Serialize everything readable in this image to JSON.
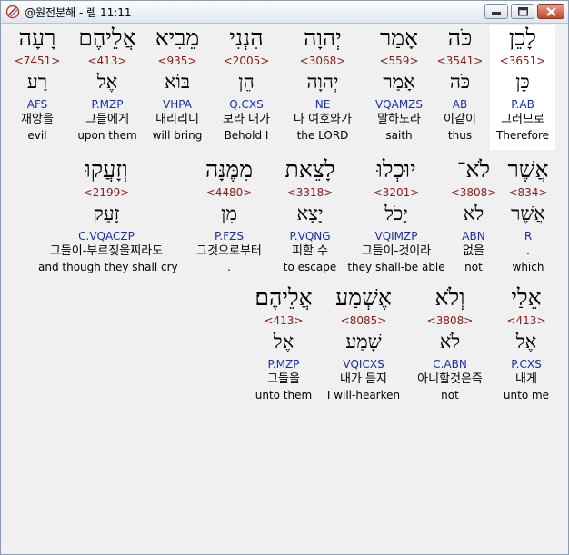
{
  "window": {
    "title": "@원전분해 - 렘 11:11"
  },
  "rows": [
    [
      {
        "hebrew": "רָעָה",
        "strong": "<7451>",
        "lemma": "רַע",
        "morph": "AFS",
        "korean": "재앙을",
        "english": "evil"
      },
      {
        "hebrew": "אֲלֵיהֶם",
        "strong": "<413>",
        "lemma": "אֶל",
        "morph": "P.MZP",
        "korean": "그들에게",
        "english": "upon them"
      },
      {
        "hebrew": "מֵבִיא",
        "strong": "<935>",
        "lemma": "בּוֹא",
        "morph": "VHPA",
        "korean": "내리리니",
        "english": "will bring"
      },
      {
        "hebrew": "הִנְנִי",
        "strong": "<2005>",
        "lemma": "הֵן",
        "morph": "Q.CXS",
        "korean": "보라 내가",
        "english": "Behold I"
      },
      {
        "hebrew": "יְהוָה",
        "strong": "<3068>",
        "lemma": "יְהוָה",
        "morph": "NE",
        "korean": "나 여호와가",
        "english": "the LORD"
      },
      {
        "hebrew": "אָמַר",
        "strong": "<559>",
        "lemma": "אָמַר",
        "morph": "VQAMZS",
        "korean": "말하노라",
        "english": "saith"
      },
      {
        "hebrew": "כֹּה",
        "strong": "<3541>",
        "lemma": "כֹּה",
        "morph": "AB",
        "korean": "이같이",
        "english": "thus"
      },
      {
        "hebrew": "לָכֵן",
        "strong": "<3651>",
        "lemma": "כֵּן",
        "morph": "P.AB",
        "korean": "그러므로",
        "english": "Therefore"
      }
    ],
    [
      {
        "hebrew": "וְזָעֲקוּ",
        "strong": "<2199>",
        "lemma": "זָעַק",
        "morph": "C.VQACZP",
        "korean": "그들이-부르짖을찌라도",
        "english": "and though they shall cry"
      },
      {
        "hebrew": "מִמֶּנָּה",
        "strong": "<4480>",
        "lemma": "מִן",
        "morph": "P.FZS",
        "korean": "그것으로부터",
        "english": "."
      },
      {
        "hebrew": "לָצֵאת",
        "strong": "<3318>",
        "lemma": "יָצָא",
        "morph": "P.VQNG",
        "korean": "피할 수",
        "english": "to escape"
      },
      {
        "hebrew": "יוּכְלוּ",
        "strong": "<3201>",
        "lemma": "יָכֹל",
        "morph": "VQIMZP",
        "korean": "그들이-것이라",
        "english": "they shall-be able"
      },
      {
        "hebrew": "לֹא־",
        "strong": "<3808>",
        "lemma": "לֹא",
        "morph": "ABN",
        "korean": "없을",
        "english": "not"
      },
      {
        "hebrew": "אֲשֶׁר",
        "strong": "<834>",
        "lemma": "אֲשֶׁר",
        "morph": "R",
        "korean": ".",
        "english": "which"
      }
    ],
    [
      {
        "hebrew": "אֲלֵיהֶם׃",
        "strong": "<413>",
        "lemma": "אֶל",
        "morph": "P.MZP",
        "korean": "그들을",
        "english": "unto them"
      },
      {
        "hebrew": "אֶשְׁמַע",
        "strong": "<8085>",
        "lemma": "שָׁמַע",
        "morph": "VQICXS",
        "korean": "내가 듣지",
        "english": "I will-hearken"
      },
      {
        "hebrew": "וְלֹא",
        "strong": "<3808>",
        "lemma": "לֹא",
        "morph": "C.ABN",
        "korean": "아니할것은즉",
        "english": "not"
      },
      {
        "hebrew": "אֵלַי",
        "strong": "<413>",
        "lemma": "אֶל",
        "morph": "P.CXS",
        "korean": "내게",
        "english": "unto me"
      }
    ]
  ]
}
